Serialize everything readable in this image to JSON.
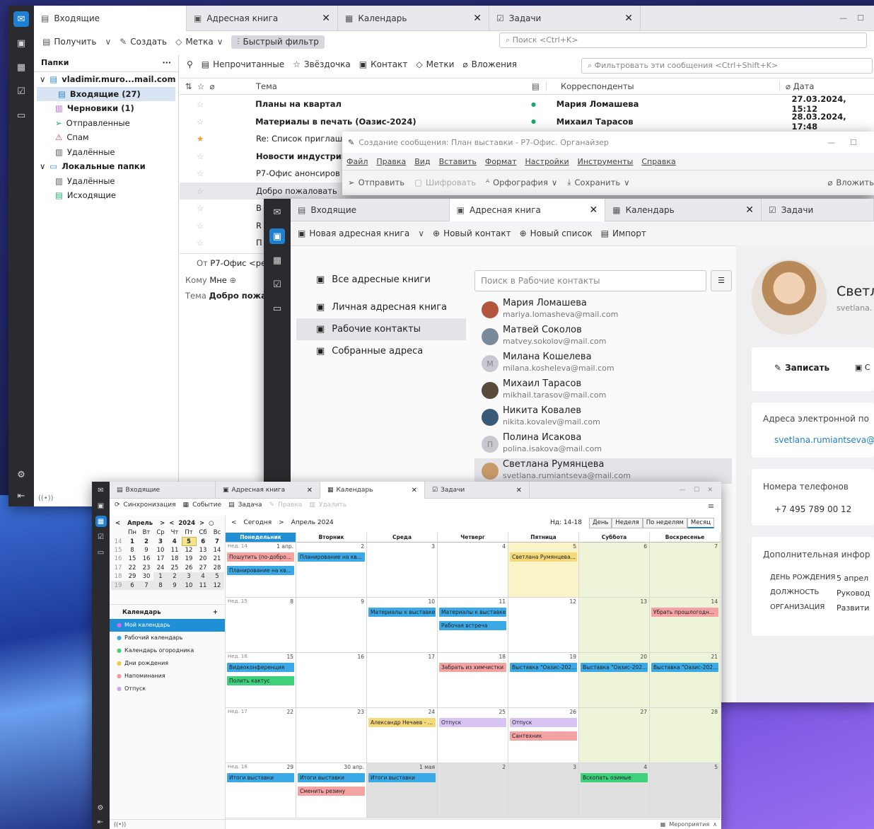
{
  "colors": {
    "accent": "#1f7fd1",
    "orange": "#f59c3f",
    "red_evt": "#f4a2a2",
    "blue_evt": "#3aa9e6",
    "yellow_evt": "#f4d97a",
    "purple_evt": "#d8c4f3",
    "green_evt": "#3dd17b"
  },
  "mail": {
    "tabs": [
      {
        "label": "Входящие",
        "icon": "inbox-icon"
      },
      {
        "label": "Адресная книга",
        "icon": "addressbook-icon"
      },
      {
        "label": "Календарь",
        "icon": "calendar-icon"
      },
      {
        "label": "Задачи",
        "icon": "tasks-icon"
      }
    ],
    "toolbar": {
      "get": "Получить",
      "create": "Создать",
      "tag": "Метка",
      "quick_filter": "Быстрый фильтр",
      "search": "Поиск <Ctrl+K>"
    },
    "folders_header": "Папки",
    "folders": [
      {
        "label": "vladimir.muro...mail.com",
        "bold": true,
        "level": 0,
        "icon": "account-icon"
      },
      {
        "label": "Входящие (27)",
        "bold": true,
        "level": 1,
        "icon": "inbox-icon",
        "selected": true
      },
      {
        "label": "Черновики (1)",
        "bold": true,
        "level": 1,
        "icon": "drafts-icon"
      },
      {
        "label": "Отправленные",
        "bold": false,
        "level": 1,
        "icon": "sent-icon"
      },
      {
        "label": "Спам",
        "bold": false,
        "level": 1,
        "icon": "spam-icon"
      },
      {
        "label": "Удалённые",
        "bold": false,
        "level": 1,
        "icon": "trash-icon"
      },
      {
        "label": "Локальные папки",
        "bold": true,
        "level": 0,
        "icon": "folder-icon"
      },
      {
        "label": "Удалённые",
        "bold": false,
        "level": 1,
        "icon": "trash-icon"
      },
      {
        "label": "Исходящие",
        "bold": false,
        "level": 1,
        "icon": "outbox-icon"
      }
    ],
    "filters": {
      "unread": "Непрочитанные",
      "star": "Звёздочка",
      "contact": "Контакт",
      "tags": "Метки",
      "attach": "Вложения",
      "filter_search": "Фильтровать эти сообщения <Ctrl+Shift+K>"
    },
    "columns": {
      "subject": "Тема",
      "correspondents": "Корреспонденты",
      "date": "Дата"
    },
    "messages": [
      {
        "subject": "Планы на квартал",
        "bold": true,
        "from": "Мария Ломашева",
        "date": "27.03.2024, 15:12",
        "star": false
      },
      {
        "subject": "Материалы в печать (Оазис-2024)",
        "bold": true,
        "from": "Михаил Тарасов",
        "date": "28.03.2024, 17:48",
        "star": false
      },
      {
        "subject": "Re: Список приглаш",
        "bold": false,
        "from": "",
        "date": "",
        "star": true
      },
      {
        "subject": "Новости индустрии",
        "bold": true,
        "from": "",
        "date": "",
        "star": false
      },
      {
        "subject": "Р7-Офис анонсиров",
        "bold": false,
        "from": "",
        "date": "",
        "star": false
      },
      {
        "subject": "Добро пожаловать",
        "bold": false,
        "from": "",
        "date": "",
        "star": false
      },
      {
        "subject": "В",
        "bold": false,
        "from": "",
        "date": "",
        "star": false
      },
      {
        "subject": "R",
        "bold": false,
        "from": "",
        "date": "",
        "star": false
      },
      {
        "subject": "П",
        "bold": false,
        "from": "",
        "date": "",
        "star": false
      }
    ],
    "preview": {
      "from_label": "От",
      "from": "Р7-Офис <ре",
      "to_label": "Кому",
      "to": "Мне",
      "subj_label": "Тема",
      "subj": "Добро пожа"
    }
  },
  "compose": {
    "title": "Создание сообщения: План выставки - Р7-Офис. Органайзер",
    "menu": [
      "Файл",
      "Правка",
      "Вид",
      "Вставить",
      "Формат",
      "Настройки",
      "Инструменты",
      "Справка"
    ],
    "toolbar": {
      "send": "Отправить",
      "encrypt": "Шифровать",
      "spell": "Орфография",
      "save": "Сохранить",
      "attach": "Вложить"
    }
  },
  "ab": {
    "tabs": [
      {
        "label": "Входящие"
      },
      {
        "label": "Адресная книга"
      },
      {
        "label": "Календарь"
      },
      {
        "label": "Задачи"
      }
    ],
    "toolbar": {
      "new_book": "Новая адресная книга",
      "new_contact": "Новый контакт",
      "new_list": "Новый список",
      "import": "Импорт"
    },
    "books": [
      "Все адресные книги",
      "Личная адресная книга",
      "Рабочие контакты",
      "Собранные адреса"
    ],
    "search": "Поиск в Рабочие контакты",
    "contacts": [
      {
        "name": "Мария Ломашева",
        "mail": "mariya.lomasheva@mail.com",
        "initial": ""
      },
      {
        "name": "Матвей Соколов",
        "mail": "matvey.sokolov@mail.com",
        "initial": ""
      },
      {
        "name": "Милана Кошелева",
        "mail": "milana.kosheleva@mail.com",
        "initial": "М"
      },
      {
        "name": "Михаил Тарасов",
        "mail": "mikhail.tarasov@mail.com",
        "initial": ""
      },
      {
        "name": "Никита Ковалев",
        "mail": "nikita.kovalev@mail.com",
        "initial": ""
      },
      {
        "name": "Полина Исакова",
        "mail": "polina.isakova@mail.com",
        "initial": "П"
      },
      {
        "name": "Светлана Румянцева",
        "mail": "svetlana.rumiantseva@mail.com",
        "initial": ""
      }
    ],
    "detail": {
      "name": "Светл",
      "sub": "svetlana.",
      "write": "Записать",
      "email_h": "Адреса электронной по",
      "email": "svetlana.rumiantseva@",
      "phone_h": "Номера телефонов",
      "phone": "+7 495 789 00 12",
      "more_h": "Дополнительная инфор",
      "rows": [
        {
          "k": "ДЕНЬ РОЖДЕНИЯ",
          "v": "5 апрел"
        },
        {
          "k": "ДОЛЖНОСТЬ",
          "v": "Руковод"
        },
        {
          "k": "ОРГАНИЗАЦИЯ",
          "v": "Развити"
        }
      ]
    }
  },
  "cal": {
    "tabs": [
      {
        "label": "Входящие"
      },
      {
        "label": "Адресная книга"
      },
      {
        "label": "Календарь"
      },
      {
        "label": "Задачи"
      }
    ],
    "toolbar": {
      "sync": "Синхронизация",
      "event": "Событие",
      "task": "Задача",
      "edit": "Правка",
      "delete": "Удалить"
    },
    "mini": {
      "month": "Апрель",
      "year": "2024",
      "dow": [
        "Пн",
        "Вт",
        "Ср",
        "Чт",
        "Пт",
        "Сб",
        "Вс"
      ],
      "weeks": [
        [
          "14",
          "1",
          "2",
          "3",
          "4",
          "5",
          "6",
          "7"
        ],
        [
          "15",
          "8",
          "9",
          "10",
          "11",
          "12",
          "13",
          "14"
        ],
        [
          "16",
          "15",
          "16",
          "17",
          "18",
          "19",
          "20",
          "21"
        ],
        [
          "17",
          "22",
          "23",
          "24",
          "25",
          "26",
          "27",
          "28"
        ],
        [
          "18",
          "29",
          "30",
          "1",
          "2",
          "3",
          "4",
          "5"
        ],
        [
          "19",
          "6",
          "7",
          "8",
          "9",
          "10",
          "11",
          "12"
        ]
      ]
    },
    "calendars_h": "Календарь",
    "calendars": [
      {
        "label": "Мой календарь",
        "color": "#d66bf0"
      },
      {
        "label": "Рабочий календарь",
        "color": "#3aa9e6"
      },
      {
        "label": "Календарь огородника",
        "color": "#3dd17b"
      },
      {
        "label": "Дни рождения",
        "color": "#f4c842"
      },
      {
        "label": "Напоминания",
        "color": "#f49a9a"
      },
      {
        "label": "Отпуск",
        "color": "#c8a8f0"
      }
    ],
    "nav": {
      "today": "Сегодня",
      "period": "Апрель 2024",
      "week": "Нд: 14-18",
      "views": [
        "День",
        "Неделя",
        "По неделям",
        "Месяц"
      ]
    },
    "days": [
      "Понедельник",
      "Вторник",
      "Среда",
      "Четверг",
      "Пятница",
      "Суббота",
      "Воскресенье"
    ],
    "rows": [
      {
        "wk": "Нед. 14",
        "nums": [
          "1 апр.",
          "2",
          "3",
          "4",
          "5",
          "6",
          "7"
        ]
      },
      {
        "wk": "Нед. 15",
        "nums": [
          "8",
          "9",
          "10",
          "11",
          "12",
          "13",
          "14"
        ]
      },
      {
        "wk": "Нед. 16",
        "nums": [
          "15",
          "16",
          "17",
          "18",
          "19",
          "20",
          "21"
        ]
      },
      {
        "wk": "Нед. 17",
        "nums": [
          "22",
          "23",
          "24",
          "25",
          "26",
          "27",
          "28"
        ]
      },
      {
        "wk": "Нед. 18",
        "nums": [
          "29",
          "30 апр.",
          "1 мая",
          "2",
          "3",
          "4",
          "5"
        ]
      }
    ],
    "events": [
      {
        "r": 0,
        "c": 0,
        "slot": 0,
        "t": "Пошутить (по-добро...",
        "k": "red_evt"
      },
      {
        "r": 0,
        "c": 0,
        "slot": 1,
        "t": "Планирование на кв...",
        "k": "blue_evt"
      },
      {
        "r": 0,
        "c": 1,
        "slot": 0,
        "t": "Планирование на кв...",
        "k": "blue_evt"
      },
      {
        "r": 0,
        "c": 4,
        "slot": 0,
        "t": "Светлана Румянцева...",
        "k": "yellow_evt"
      },
      {
        "r": 1,
        "c": 2,
        "slot": 0,
        "t": "Материалы к выставке",
        "k": "blue_evt"
      },
      {
        "r": 1,
        "c": 3,
        "slot": 0,
        "t": "Материалы к выставке",
        "k": "blue_evt"
      },
      {
        "r": 1,
        "c": 3,
        "slot": 1,
        "t": "Рабочая встреча",
        "k": "blue_evt"
      },
      {
        "r": 1,
        "c": 6,
        "slot": 0,
        "t": "Убрать прошлогодн...",
        "k": "red_evt"
      },
      {
        "r": 2,
        "c": 0,
        "slot": 0,
        "t": "Видеоконференция",
        "k": "blue_evt"
      },
      {
        "r": 2,
        "c": 0,
        "slot": 1,
        "t": "Полить кактус",
        "k": "green_evt"
      },
      {
        "r": 2,
        "c": 3,
        "slot": 0,
        "t": "Забрать из химчистки",
        "k": "red_evt"
      },
      {
        "r": 2,
        "c": 4,
        "slot": 0,
        "t": "Выставка \"Оазис-202...",
        "k": "blue_evt"
      },
      {
        "r": 2,
        "c": 5,
        "slot": 0,
        "t": "Выставка \"Оазис-202...",
        "k": "blue_evt"
      },
      {
        "r": 2,
        "c": 6,
        "slot": 0,
        "t": "Выставка \"Оазис-202...",
        "k": "blue_evt"
      },
      {
        "r": 3,
        "c": 2,
        "slot": 0,
        "t": "Александр Нечаев - ...",
        "k": "yellow_evt"
      },
      {
        "r": 3,
        "c": 3,
        "slot": 0,
        "t": "Отпуск",
        "k": "purple_evt"
      },
      {
        "r": 3,
        "c": 4,
        "slot": 0,
        "t": "Отпуск",
        "k": "purple_evt"
      },
      {
        "r": 3,
        "c": 4,
        "slot": 1,
        "t": "Сантехник",
        "k": "red_evt"
      },
      {
        "r": 4,
        "c": 0,
        "slot": 0,
        "t": "Итоги выставки",
        "k": "blue_evt"
      },
      {
        "r": 4,
        "c": 1,
        "slot": 0,
        "t": "Итоги выставки",
        "k": "blue_evt"
      },
      {
        "r": 4,
        "c": 1,
        "slot": 1,
        "t": "Сменить резину",
        "k": "red_evt"
      },
      {
        "r": 4,
        "c": 2,
        "slot": 0,
        "t": "Итоги выставки",
        "k": "blue_evt"
      },
      {
        "r": 4,
        "c": 5,
        "slot": 0,
        "t": "Вскопать озимые",
        "k": "green_evt"
      }
    ],
    "footer": "Мероприятия"
  }
}
